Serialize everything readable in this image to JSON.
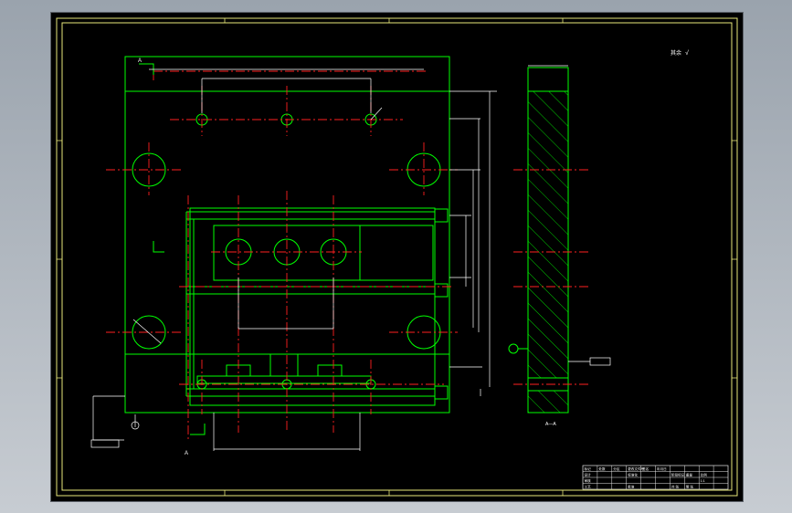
{
  "labels": {
    "section_a_top": "A",
    "section_a_bottom": "A",
    "section_view": "A—A",
    "roughness_note": "其余",
    "callout_left": "",
    "callout_right": ""
  },
  "title_block": {
    "rows": [
      [
        "标记",
        "处数",
        "分区",
        "更改文件号",
        "签名",
        "年月日",
        "",
        "",
        "",
        ""
      ],
      [
        "设计",
        "",
        "",
        "标准化",
        "",
        "",
        "阶段标记",
        "重量",
        "比例",
        ""
      ],
      [
        "审核",
        "",
        "",
        "",
        "",
        "",
        "",
        "",
        "1:1",
        ""
      ],
      [
        "工艺",
        "",
        "",
        "批准",
        "",
        "",
        "共 张",
        "第 张",
        "",
        ""
      ]
    ]
  },
  "colors": {
    "background": "#000000",
    "outline": "#00ff00",
    "centerline": "#ff0000",
    "dimension": "#ffffff",
    "frame": "#ffff66",
    "hatch": "#00ff00"
  }
}
